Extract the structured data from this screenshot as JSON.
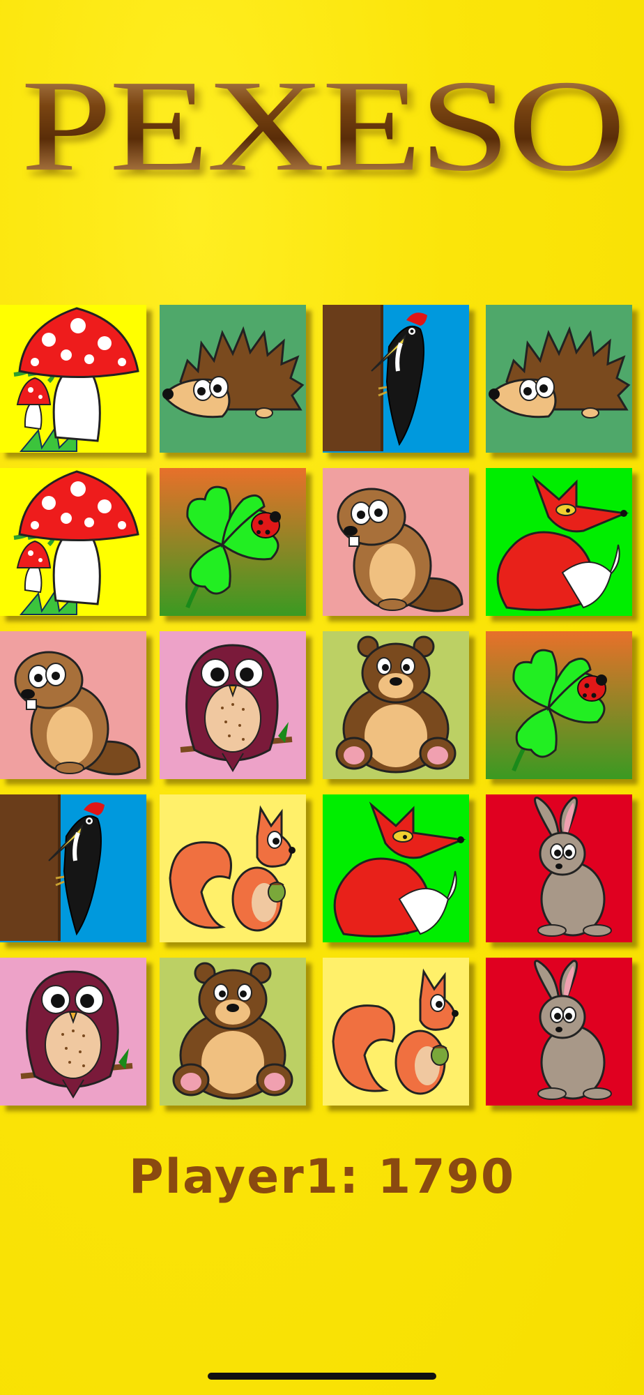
{
  "title": "PEXESO",
  "board": {
    "rows": 5,
    "columns": 4,
    "cards": [
      {
        "picture": "mushroom",
        "background": "#ffff00"
      },
      {
        "picture": "hedgehog",
        "background": "#4fa86a"
      },
      {
        "picture": "woodpecker",
        "background": "#0099dd"
      },
      {
        "picture": "hedgehog",
        "background": "#4fa86a"
      },
      {
        "picture": "mushroom",
        "background": "#ffff00"
      },
      {
        "picture": "clover-with-ladybug",
        "background": "gradient-orange-green"
      },
      {
        "picture": "beaver",
        "background": "#f0a0a0"
      },
      {
        "picture": "fox",
        "background": "#00ee00"
      },
      {
        "picture": "beaver",
        "background": "#f0a0a0"
      },
      {
        "picture": "owl",
        "background": "#eda2c8"
      },
      {
        "picture": "bear",
        "background": "#bcd064"
      },
      {
        "picture": "clover-with-ladybug",
        "background": "gradient-orange-green"
      },
      {
        "picture": "woodpecker",
        "background": "#0099dd"
      },
      {
        "picture": "squirrel",
        "background": "#fff06a"
      },
      {
        "picture": "fox",
        "background": "#00ee00"
      },
      {
        "picture": "rabbit",
        "background": "#e00020"
      },
      {
        "picture": "owl",
        "background": "#eda2c8"
      },
      {
        "picture": "bear",
        "background": "#bcd064"
      },
      {
        "picture": "squirrel",
        "background": "#fff06a"
      },
      {
        "picture": "rabbit",
        "background": "#e00020"
      }
    ]
  },
  "score": {
    "text": "Player1: 1790",
    "player": "Player1",
    "points": 1790
  },
  "colors": {
    "page_background": "#f7df00",
    "title": "#7a4512",
    "score_text": "#8a4a10"
  }
}
